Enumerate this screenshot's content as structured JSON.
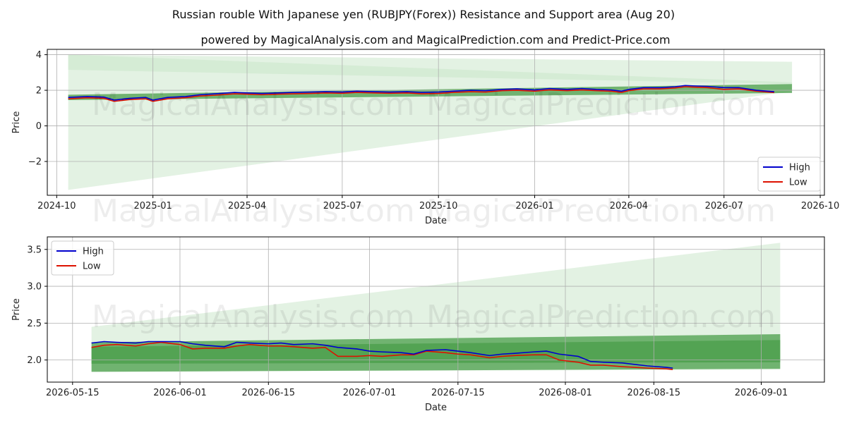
{
  "title": "Russian rouble With Japanese yen (RUBJPY(Forex)) Resistance and Support area (Aug 20)",
  "subtitle": "powered by MagicalAnalysis.com and MagicalPrediction.com and Predict-Price.com",
  "watermarks": [
    "MagicalAnalysis.com",
    "MagicalPrediction.com"
  ],
  "colors": {
    "high": "#0000cc",
    "low": "#dd1100",
    "band_dark": "#4a9e4a",
    "band_light": "#c8e6c8"
  },
  "chart_data": [
    {
      "type": "line",
      "xlabel": "Date",
      "ylabel": "Price",
      "xlim": [
        "2024-09-22",
        "2026-10-05"
      ],
      "ylim": [
        -3.9,
        4.3
      ],
      "x_ticks": [
        "2024-10",
        "2025-01",
        "2025-04",
        "2025-07",
        "2025-10",
        "2026-01",
        "2026-04",
        "2026-07",
        "2026-10"
      ],
      "y_ticks": [
        -2,
        0,
        2,
        4
      ],
      "grid": true,
      "legend": {
        "position": "lower-right",
        "entries": [
          "High",
          "Low"
        ]
      },
      "bands": [
        {
          "kind": "light",
          "x": [
            "2024-10-12",
            "2026-09-04"
          ],
          "upper": [
            4.0,
            3.6
          ],
          "lower": [
            -3.6,
            1.95
          ]
        },
        {
          "kind": "light",
          "x": [
            "2024-10-12",
            "2026-09-04"
          ],
          "upper": [
            4.0,
            2.45
          ],
          "lower": [
            3.15,
            2.35
          ]
        },
        {
          "kind": "dark",
          "x": [
            "2024-10-12",
            "2026-09-04"
          ],
          "upper": [
            1.75,
            2.35
          ],
          "lower": [
            1.45,
            1.85
          ]
        }
      ],
      "series": [
        {
          "name": "High",
          "x": [
            "2024-10-12",
            "2024-10-30",
            "2024-11-15",
            "2024-11-25",
            "2024-12-10",
            "2024-12-25",
            "2025-01-01",
            "2025-01-15",
            "2025-02-01",
            "2025-02-15",
            "2025-03-01",
            "2025-03-20",
            "2025-04-01",
            "2025-04-15",
            "2025-05-01",
            "2025-05-15",
            "2025-06-01",
            "2025-06-15",
            "2025-07-01",
            "2025-07-15",
            "2025-08-01",
            "2025-08-15",
            "2025-09-01",
            "2025-09-15",
            "2025-10-01",
            "2025-10-15",
            "2025-11-01",
            "2025-11-15",
            "2025-12-01",
            "2025-12-15",
            "2026-01-01",
            "2026-01-15",
            "2026-02-01",
            "2026-02-15",
            "2026-03-01",
            "2026-03-15",
            "2026-03-25",
            "2026-04-01",
            "2026-04-15",
            "2026-05-01",
            "2026-05-15",
            "2026-05-25",
            "2026-06-01",
            "2026-06-15",
            "2026-07-01",
            "2026-07-15",
            "2026-08-01",
            "2026-08-18"
          ],
          "values": [
            1.6,
            1.65,
            1.62,
            1.45,
            1.55,
            1.6,
            1.45,
            1.6,
            1.65,
            1.75,
            1.8,
            1.88,
            1.85,
            1.82,
            1.85,
            1.88,
            1.9,
            1.92,
            1.9,
            1.95,
            1.92,
            1.9,
            1.92,
            1.88,
            1.9,
            1.95,
            2.0,
            1.98,
            2.05,
            2.08,
            2.02,
            2.1,
            2.05,
            2.1,
            2.05,
            2.02,
            1.95,
            2.05,
            2.15,
            2.15,
            2.2,
            2.27,
            2.25,
            2.22,
            2.15,
            2.15,
            2.0,
            1.92
          ]
        },
        {
          "name": "Low",
          "x": [
            "2024-10-12",
            "2024-10-30",
            "2024-11-15",
            "2024-11-25",
            "2024-12-10",
            "2024-12-25",
            "2025-01-01",
            "2025-01-15",
            "2025-02-01",
            "2025-02-15",
            "2025-03-01",
            "2025-03-20",
            "2025-04-01",
            "2025-04-15",
            "2025-05-01",
            "2025-05-15",
            "2025-06-01",
            "2025-06-15",
            "2025-07-01",
            "2025-07-15",
            "2025-08-01",
            "2025-08-15",
            "2025-09-01",
            "2025-09-15",
            "2025-10-01",
            "2025-10-15",
            "2025-11-01",
            "2025-11-15",
            "2025-12-01",
            "2025-12-15",
            "2026-01-01",
            "2026-01-15",
            "2026-02-01",
            "2026-02-15",
            "2026-03-01",
            "2026-03-15",
            "2026-03-25",
            "2026-04-01",
            "2026-04-15",
            "2026-05-01",
            "2026-05-15",
            "2026-05-25",
            "2026-06-01",
            "2026-06-15",
            "2026-07-01",
            "2026-07-15",
            "2026-08-01",
            "2026-08-18"
          ],
          "values": [
            1.52,
            1.58,
            1.55,
            1.38,
            1.48,
            1.52,
            1.38,
            1.52,
            1.58,
            1.68,
            1.72,
            1.8,
            1.78,
            1.75,
            1.78,
            1.8,
            1.82,
            1.85,
            1.83,
            1.88,
            1.85,
            1.83,
            1.85,
            1.8,
            1.82,
            1.88,
            1.92,
            1.9,
            1.98,
            2.0,
            1.95,
            2.02,
            1.98,
            2.02,
            1.98,
            1.95,
            1.88,
            1.98,
            2.08,
            2.08,
            2.13,
            2.2,
            2.18,
            2.15,
            2.05,
            2.08,
            1.95,
            1.87
          ]
        }
      ]
    },
    {
      "type": "line",
      "xlabel": "Date",
      "ylabel": "Price",
      "xlim": [
        "2026-05-11",
        "2026-09-11"
      ],
      "ylim": [
        1.7,
        3.67
      ],
      "x_ticks": [
        "2026-05-15",
        "2026-06-01",
        "2026-06-15",
        "2026-07-01",
        "2026-07-15",
        "2026-08-01",
        "2026-08-15",
        "2026-09-01"
      ],
      "y_ticks": [
        "2.0",
        "2.5",
        "3.0",
        "3.5"
      ],
      "grid": true,
      "legend": {
        "position": "upper-left",
        "entries": [
          "High",
          "Low"
        ]
      },
      "bands": [
        {
          "kind": "light",
          "x": [
            "2026-05-18",
            "2026-09-04"
          ],
          "upper": [
            2.45,
            3.59
          ],
          "lower": [
            1.84,
            1.87
          ]
        },
        {
          "kind": "dark",
          "x": [
            "2026-05-18",
            "2026-09-04"
          ],
          "upper": [
            2.24,
            2.35
          ],
          "lower": [
            1.84,
            1.88
          ]
        },
        {
          "kind": "dark",
          "x": [
            "2026-05-18",
            "2026-09-04"
          ],
          "upper": [
            2.18,
            2.27
          ],
          "lower": [
            1.95,
            1.97
          ]
        }
      ],
      "series": [
        {
          "name": "High",
          "x": [
            "2026-05-18",
            "2026-05-20",
            "2026-05-22",
            "2026-05-25",
            "2026-05-27",
            "2026-05-29",
            "2026-06-01",
            "2026-06-03",
            "2026-06-05",
            "2026-06-08",
            "2026-06-10",
            "2026-06-12",
            "2026-06-15",
            "2026-06-17",
            "2026-06-19",
            "2026-06-22",
            "2026-06-24",
            "2026-06-26",
            "2026-06-29",
            "2026-07-01",
            "2026-07-03",
            "2026-07-06",
            "2026-07-08",
            "2026-07-10",
            "2026-07-13",
            "2026-07-15",
            "2026-07-17",
            "2026-07-20",
            "2026-07-22",
            "2026-07-24",
            "2026-07-27",
            "2026-07-29",
            "2026-07-31",
            "2026-08-03",
            "2026-08-05",
            "2026-08-07",
            "2026-08-10",
            "2026-08-12",
            "2026-08-14",
            "2026-08-17",
            "2026-08-18"
          ],
          "values": [
            2.23,
            2.25,
            2.24,
            2.23,
            2.25,
            2.25,
            2.25,
            2.22,
            2.2,
            2.18,
            2.24,
            2.23,
            2.22,
            2.23,
            2.21,
            2.22,
            2.2,
            2.17,
            2.15,
            2.12,
            2.11,
            2.1,
            2.08,
            2.13,
            2.14,
            2.12,
            2.1,
            2.06,
            2.08,
            2.09,
            2.11,
            2.12,
            2.08,
            2.05,
            1.98,
            1.97,
            1.96,
            1.94,
            1.92,
            1.9,
            1.89
          ]
        },
        {
          "name": "Low",
          "x": [
            "2026-05-18",
            "2026-05-20",
            "2026-05-22",
            "2026-05-25",
            "2026-05-27",
            "2026-05-29",
            "2026-06-01",
            "2026-06-03",
            "2026-06-05",
            "2026-06-08",
            "2026-06-10",
            "2026-06-12",
            "2026-06-15",
            "2026-06-17",
            "2026-06-19",
            "2026-06-22",
            "2026-06-24",
            "2026-06-26",
            "2026-06-29",
            "2026-07-01",
            "2026-07-03",
            "2026-07-06",
            "2026-07-08",
            "2026-07-10",
            "2026-07-13",
            "2026-07-15",
            "2026-07-17",
            "2026-07-20",
            "2026-07-22",
            "2026-07-24",
            "2026-07-27",
            "2026-07-29",
            "2026-07-31",
            "2026-08-03",
            "2026-08-05",
            "2026-08-07",
            "2026-08-10",
            "2026-08-12",
            "2026-08-14",
            "2026-08-17",
            "2026-08-18"
          ],
          "values": [
            2.17,
            2.2,
            2.21,
            2.19,
            2.22,
            2.24,
            2.21,
            2.15,
            2.16,
            2.16,
            2.19,
            2.21,
            2.19,
            2.19,
            2.18,
            2.16,
            2.17,
            2.05,
            2.05,
            2.06,
            2.05,
            2.07,
            2.07,
            2.12,
            2.1,
            2.08,
            2.07,
            2.03,
            2.05,
            2.06,
            2.07,
            2.07,
            2.0,
            1.97,
            1.93,
            1.93,
            1.91,
            1.9,
            1.89,
            1.88,
            1.87
          ]
        }
      ]
    }
  ]
}
